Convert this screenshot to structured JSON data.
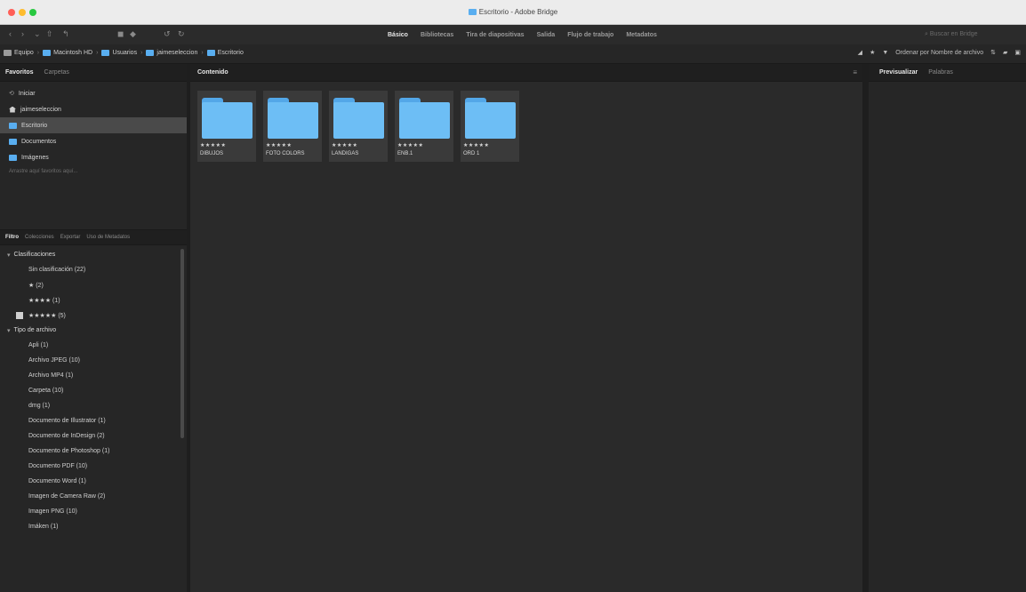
{
  "window": {
    "title": "Escritorio - Adobe Bridge"
  },
  "toolbar": {
    "workspaces": [
      {
        "label": "Básico",
        "active": true
      },
      {
        "label": "Bibliotecas",
        "active": false
      },
      {
        "label": "Tira de diapositivas",
        "active": false
      },
      {
        "label": "Salida",
        "active": false
      },
      {
        "label": "Flujo de trabajo",
        "active": false
      },
      {
        "label": "Metadatos",
        "active": false
      }
    ],
    "search_placeholder": "Buscar en Bridge"
  },
  "pathbar": {
    "crumbs": [
      "Equipo",
      "Macintosh HD",
      "Usuarios",
      "jaimeseleccion",
      "Escritorio"
    ],
    "sort_label": "Ordenar por Nombre de archivo"
  },
  "left_panel": {
    "tabs": [
      "Favoritos",
      "Carpetas"
    ],
    "favorites": [
      {
        "label": "Iniciar",
        "icon": "bridge-icon",
        "selected": false
      },
      {
        "label": "jaimeseleccion",
        "icon": "home-icon",
        "selected": false
      },
      {
        "label": "Escritorio",
        "icon": "folder-icon",
        "selected": true
      },
      {
        "label": "Documentos",
        "icon": "folder-icon",
        "selected": false
      },
      {
        "label": "Imágenes",
        "icon": "folder-icon",
        "selected": false
      }
    ],
    "favorites_hint": "Arrastre aquí favoritos aquí..."
  },
  "filter_panel": {
    "tabs": [
      "Filtro",
      "Colecciones",
      "Exportar",
      "Uso de Metadatos"
    ],
    "groups": [
      {
        "label": "Clasificaciones",
        "items": [
          {
            "label": "Sin clasificación (22)",
            "checked": false
          },
          {
            "label": "★ (2)",
            "checked": false
          },
          {
            "label": "★★★★ (1)",
            "checked": false
          },
          {
            "label": "★★★★★ (5)",
            "checked": true
          }
        ]
      },
      {
        "label": "Tipo de archivo",
        "items": [
          {
            "label": "Apli (1)",
            "checked": false
          },
          {
            "label": "Archivo JPEG (10)",
            "checked": false
          },
          {
            "label": "Archivo MP4 (1)",
            "checked": false
          },
          {
            "label": "Carpeta (10)",
            "checked": false
          },
          {
            "label": "dmg (1)",
            "checked": false
          },
          {
            "label": "Documento de Illustrator (1)",
            "checked": false
          },
          {
            "label": "Documento de InDesign (2)",
            "checked": false
          },
          {
            "label": "Documento de Photoshop (1)",
            "checked": false
          },
          {
            "label": "Documento PDF (10)",
            "checked": false
          },
          {
            "label": "Documento Word (1)",
            "checked": false
          },
          {
            "label": "Imagen de Camera Raw (2)",
            "checked": false
          },
          {
            "label": "Imagen PNG (10)",
            "checked": false
          },
          {
            "label": "Imáken (1)",
            "checked": false
          }
        ]
      }
    ]
  },
  "content": {
    "tab": "Contenido",
    "items": [
      {
        "name": "DIBUJOS",
        "rating": "★★★★★"
      },
      {
        "name": "FOTO COLORS",
        "rating": "★★★★★"
      },
      {
        "name": "LANDIGAS",
        "rating": "★★★★★"
      },
      {
        "name": "ENB.1",
        "rating": "★★★★★"
      },
      {
        "name": "ORD 1",
        "rating": "★★★★★"
      }
    ]
  },
  "right_panel": {
    "tabs": [
      "Previsualizar",
      "Palabras"
    ]
  },
  "colors": {
    "folder": "#6dbef5",
    "folder_tab": "#53a7e8",
    "selection": "#4a4a4a"
  }
}
